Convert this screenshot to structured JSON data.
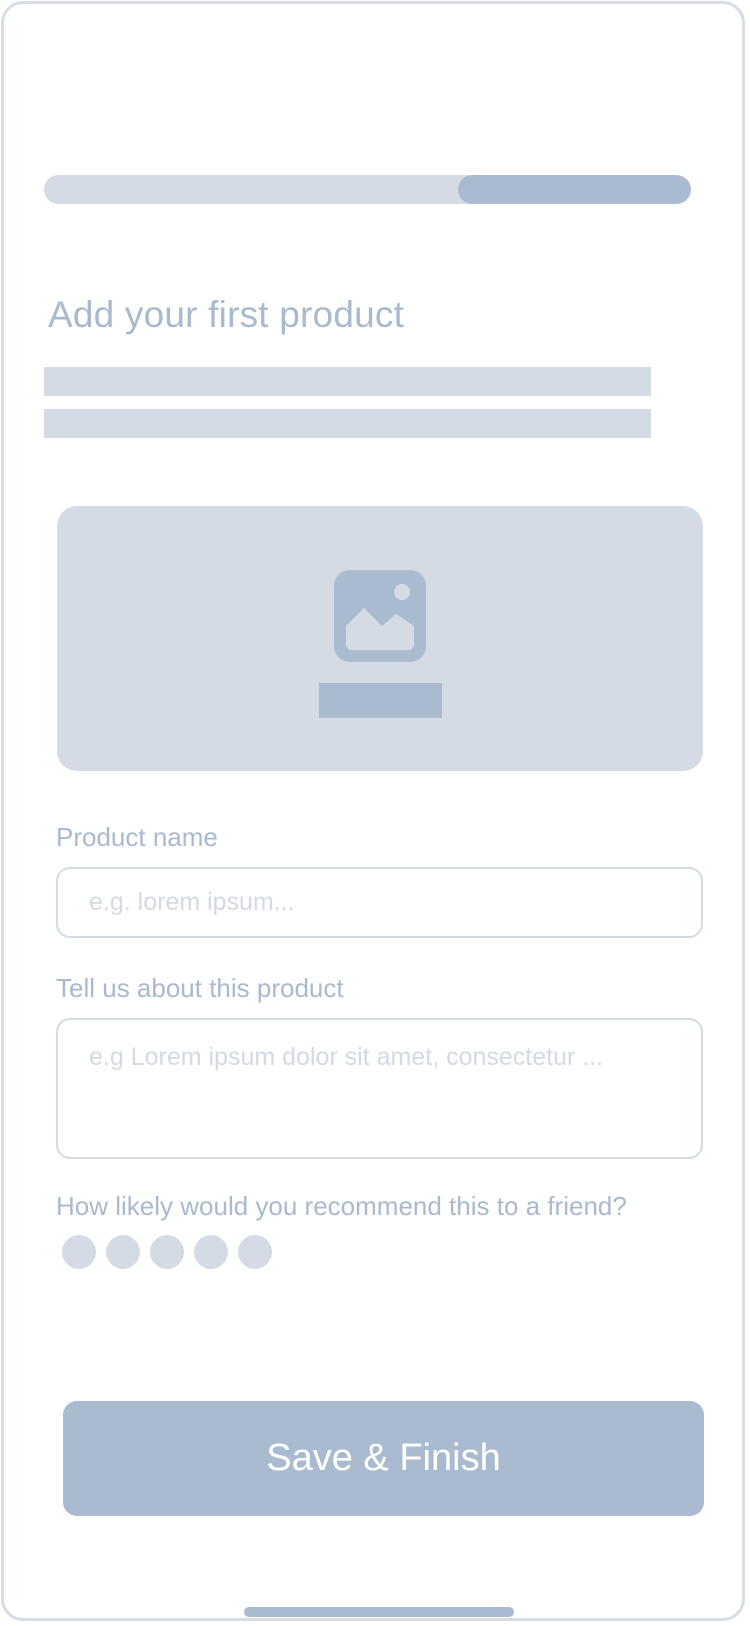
{
  "colors": {
    "accent": "#aabacf",
    "muted": "#d4dbe5",
    "text": "#a9b9ce"
  },
  "progress": {
    "value": 0.36,
    "position": "end"
  },
  "page_title": "Add your first product",
  "image_upload": {
    "icon": "image-icon"
  },
  "product_name": {
    "label": "Product name",
    "placeholder": "e.g. lorem ipsum...",
    "value": ""
  },
  "description": {
    "label": "Tell us about this product",
    "placeholder": "e.g Lorem ipsum dolor sit amet, consectetur ...",
    "value": ""
  },
  "rating": {
    "question": "How likely would you recommend this to a friend?",
    "max": 5,
    "selected": 0
  },
  "save_button": {
    "label": "Save & Finish"
  }
}
